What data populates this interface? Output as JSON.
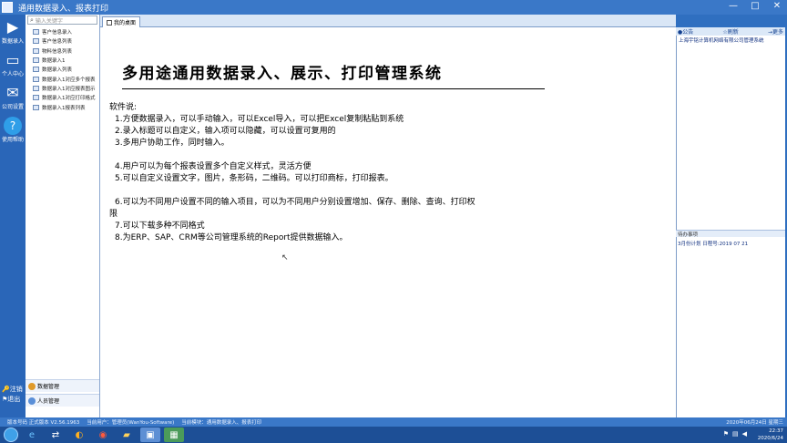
{
  "window": {
    "title": "通用数据录入、报表打印",
    "controls": [
      "—",
      "□",
      "✕"
    ]
  },
  "iconbar": {
    "items": [
      {
        "icon": "play-icon",
        "label": "数据录入"
      },
      {
        "icon": "monitor-icon",
        "label": "个人中心"
      },
      {
        "icon": "mail-icon",
        "label": "公司设置"
      },
      {
        "icon": "help-icon",
        "label": "使用帮助"
      }
    ],
    "logout": "注销",
    "exit": "退出"
  },
  "nav": {
    "search_placeholder": "输入关键字",
    "items": [
      "客户信息录入",
      "客户信息列表",
      "物料信息列表",
      "数据录入1",
      "数据录入列表",
      "数据录入1对应多个报表",
      "数据录入1对应报表图示",
      "数据录入1对应打印格式",
      "数据录入1报表列表"
    ],
    "bottom_buttons": [
      "数据管理",
      "人员管理"
    ]
  },
  "tab": {
    "label": "我的桌面"
  },
  "content": {
    "heading": "多用途通用数据录入、展示、打印管理系统",
    "intro": "软件说:",
    "lines": [
      "1.方便数据录入，可以手动输入，可以Excel导入，可以把Excel复制粘贴到系统",
      "2.录入标题可以自定义，输入项可以隐藏，可以设置可复用的",
      "3.多用户协助工作，同时输入。",
      "",
      "4.用户可以为每个报表设置多个自定义样式，灵活方便",
      "5.可以自定义设置文字，图片，条形码，二维码。可以打印商标，打印报表。",
      "",
      "6.可以为不同用户设置不同的输入项目，可以为不同用户分别设置增加、保存、删除、查询、打印权",
      "限",
      "7.可以下载多种不同格式",
      "8.为ERP、SAP、CRM等公司管理系统的Report提供数据输入。"
    ]
  },
  "rightpanel": {
    "tabs": [
      "●公告",
      "☆刷新",
      "→更多"
    ],
    "notice": "上海宇铭计算机网络有限公司管理系统",
    "section2_title": "待办事项",
    "row1": "3月份计划  日程号:2019 07 21"
  },
  "statusbar": {
    "left": "版本号码  正式版本   V2.56.1963",
    "user": "当前用户：管理员(WanYou-Software)",
    "module": "当前模块：通用数据录入、报表打印",
    "right": "2020年06月24日 星期三"
  },
  "taskbar": {
    "time": "22:37",
    "date": "2020/6/24"
  }
}
